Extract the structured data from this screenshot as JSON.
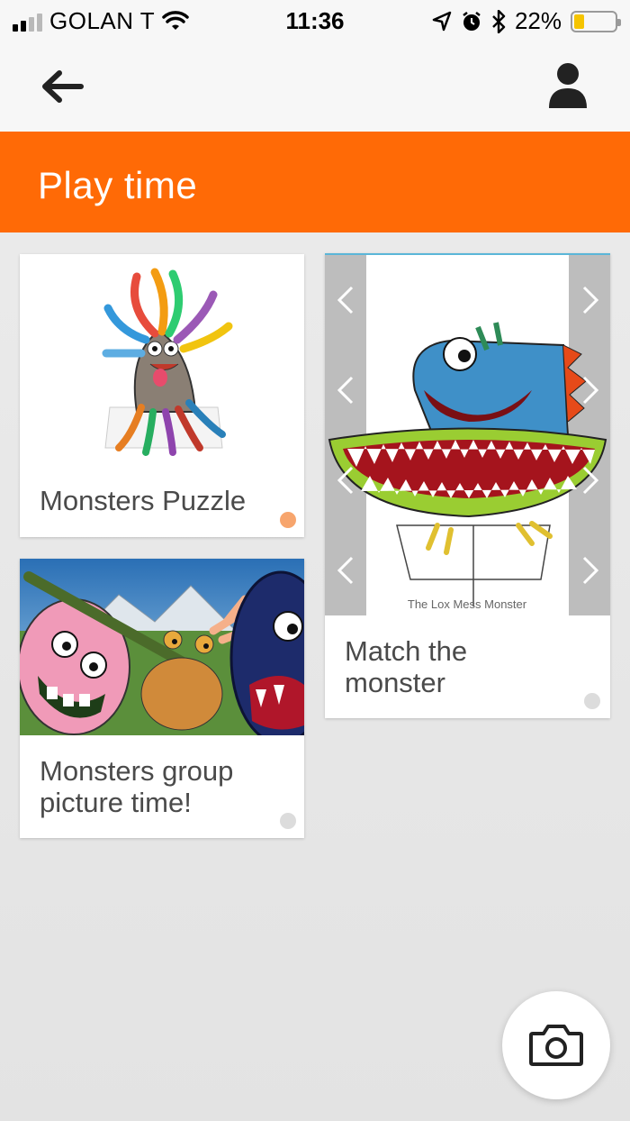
{
  "status_bar": {
    "carrier": "GOLAN T",
    "time": "11:36",
    "battery": "22%",
    "battery_level": 0.22,
    "icons": [
      "signal-icon",
      "wifi-icon",
      "location-arrow-icon",
      "alarm-icon",
      "bluetooth-icon",
      "battery-icon"
    ]
  },
  "nav": {
    "back_icon": "arrow-left-icon",
    "profile_icon": "person-icon"
  },
  "header": {
    "title": "Play time",
    "color": "#ff6a06"
  },
  "cards": [
    {
      "label": "Monsters Puzzle",
      "dot_color": "#f7a56d",
      "image": "multi-headed-snake-monster-illustration"
    },
    {
      "label": "Monsters group picture time!",
      "dot_color": "#dcdcdc",
      "image": "group-of-monsters-mountain-illustration"
    },
    {
      "label": "Match the monster",
      "dot_color": "#dcdcdc",
      "image": "toothy-monster-slider-illustration",
      "image_caption": "The Lox Mess Monster"
    }
  ],
  "fab": {
    "icon": "camera-icon"
  }
}
